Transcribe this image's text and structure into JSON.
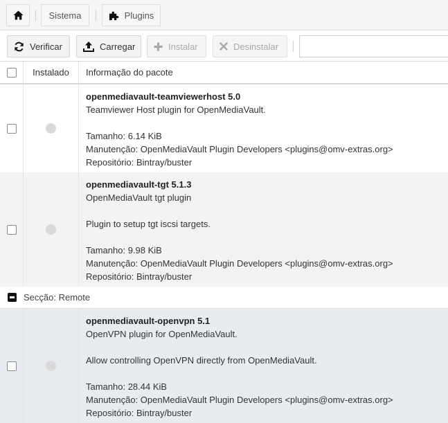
{
  "breadcrumb": {
    "home_icon": "home-icon",
    "items": [
      {
        "label": "Sistema"
      },
      {
        "label": "Plugins",
        "icon": "puzzle-icon"
      }
    ]
  },
  "toolbar": {
    "buttons": [
      {
        "label": "Verificar",
        "icon": "refresh-icon",
        "enabled": true
      },
      {
        "label": "Carregar",
        "icon": "upload-icon",
        "enabled": true
      },
      {
        "label": "Instalar",
        "icon": "plus-icon",
        "enabled": false
      },
      {
        "label": "Desinstalar",
        "icon": "close-icon",
        "enabled": false
      }
    ],
    "search_value": ""
  },
  "grid": {
    "columns": [
      "Instalado",
      "Informação do pacote"
    ],
    "rows": [
      {
        "name": "openmediavault-teamviewerhost 5.0",
        "summary": "Teamviewer Host plugin for OpenMediaVault.",
        "description": "",
        "size": "Tamanho: 6.14 KiB",
        "maintainer": "Manutenção: OpenMediaVault Plugin Developers <plugins@omv-extras.org>",
        "repository": "Repositório: Bintray/buster",
        "installed": false
      },
      {
        "name": "openmediavault-tgt 5.1.3",
        "summary": "OpenMediaVault tgt plugin",
        "description": "Plugin to setup tgt iscsi targets.",
        "size": "Tamanho: 9.98 KiB",
        "maintainer": "Manutenção: OpenMediaVault Plugin Developers <plugins@omv-extras.org>",
        "repository": "Repositório: Bintray/buster",
        "installed": false
      },
      {
        "name": "openmediavault-openvpn 5.1",
        "summary": "OpenVPN plugin for OpenMediaVault.",
        "description": "Allow controlling OpenVPN directly from OpenMediaVault.",
        "size": "Tamanho: 28.44 KiB",
        "maintainer": "Manutenção: OpenMediaVault Plugin Developers <plugins@omv-extras.org>",
        "repository": "Repositório: Bintray/buster",
        "installed": false
      }
    ],
    "section": {
      "label": "Secção: Remote"
    }
  }
}
